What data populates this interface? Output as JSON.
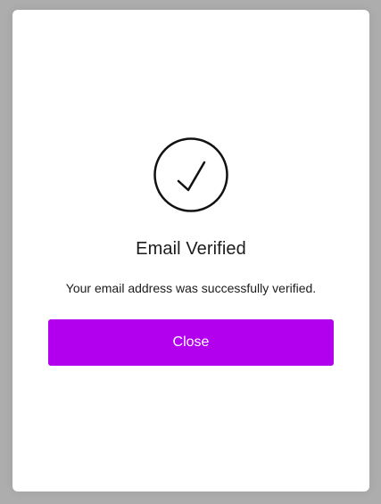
{
  "dialog": {
    "title": "Email Verified",
    "message": "Your email address was successfully verified.",
    "close_label": "Close",
    "icon": "check-circle-icon",
    "accent_color": "#b200ee"
  }
}
